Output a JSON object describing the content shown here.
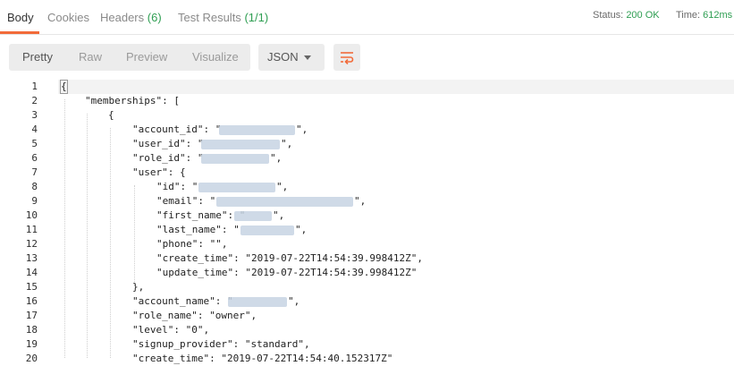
{
  "tabs": [
    {
      "label": "Body"
    },
    {
      "label": "Cookies"
    },
    {
      "label": "Headers",
      "count": "(6)"
    },
    {
      "label": "Test Results",
      "count": "(1/1)"
    }
  ],
  "status": {
    "status_label": "Status:",
    "status_value": "200 OK",
    "time_label": "Time:",
    "time_value": "612ms"
  },
  "toolbar": {
    "views": [
      "Pretty",
      "Raw",
      "Preview",
      "Visualize"
    ],
    "format": "JSON",
    "wrap_icon": "wrap-lines-icon"
  },
  "colors": {
    "accent": "#f26b3a",
    "ok": "#2e9e52"
  },
  "code_lines": [
    {
      "n": "1",
      "text": "{"
    },
    {
      "n": "2",
      "text": "\"memberships\": ["
    },
    {
      "n": "3",
      "text": "{"
    },
    {
      "n": "4",
      "text": "\"account_id\": \"",
      "tail": "\","
    },
    {
      "n": "5",
      "text": "\"user_id\": \"",
      "tail": "\","
    },
    {
      "n": "6",
      "text": "\"role_id\": \"",
      "tail": "\","
    },
    {
      "n": "7",
      "text": "\"user\": {"
    },
    {
      "n": "8",
      "text": "\"id\": \"",
      "tail": "\","
    },
    {
      "n": "9",
      "text": "\"email\": \"",
      "tail": "\","
    },
    {
      "n": "10",
      "text": "\"first_name\": \"",
      "tail": "\","
    },
    {
      "n": "11",
      "text": "\"last_name\": \"",
      "tail": "\","
    },
    {
      "n": "12",
      "text": "\"phone\": \"\","
    },
    {
      "n": "13",
      "text": "\"create_time\": \"2019-07-22T14:54:39.998412Z\","
    },
    {
      "n": "14",
      "text": "\"update_time\": \"2019-07-22T14:54:39.998412Z\""
    },
    {
      "n": "15",
      "text": "},"
    },
    {
      "n": "16",
      "text": "\"account_name\": \"",
      "tail": "\","
    },
    {
      "n": "17",
      "text": "\"role_name\": \"owner\","
    },
    {
      "n": "18",
      "text": "\"level\": \"0\","
    },
    {
      "n": "19",
      "text": "\"signup_provider\": \"standard\","
    },
    {
      "n": "20",
      "text": "\"create_time\": \"2019-07-22T14:54:40.152317Z\""
    }
  ]
}
